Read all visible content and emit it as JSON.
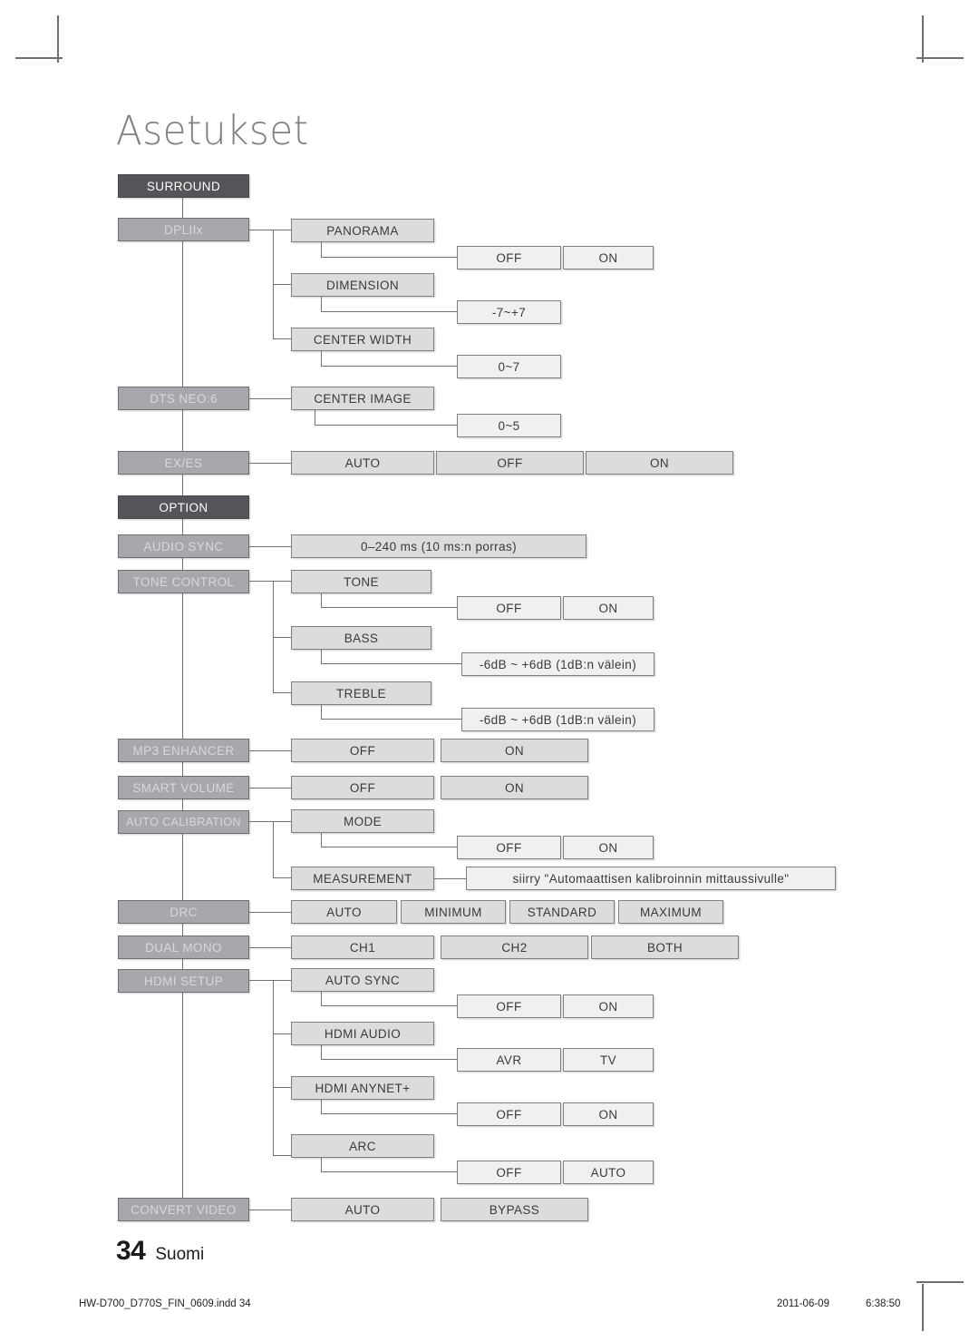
{
  "page": {
    "title": "Asetukset",
    "number": "34",
    "language": "Suomi"
  },
  "print_info": {
    "file": "HW-D700_D770S_FIN_0609.indd   34",
    "date": "2011-06-09",
    "time": "6:38:50"
  },
  "diagram": {
    "type": "tree",
    "nodes": {
      "surround": "SURROUND",
      "dpllix": "DPLIIx",
      "panorama": "PANORAMA",
      "panorama_off": "OFF",
      "panorama_on": "ON",
      "dimension": "DIMENSION",
      "dimension_range": "-7~+7",
      "center_width": "CENTER WIDTH",
      "center_width_range": "0~7",
      "dts_neo6": "DTS NEO:6",
      "center_image": "CENTER IMAGE",
      "center_image_range": "0~5",
      "ex_es": "EX/ES",
      "ex_es_auto": "AUTO",
      "ex_es_off": "OFF",
      "ex_es_on": "ON",
      "option": "OPTION",
      "audio_sync": "AUDIO SYNC",
      "audio_sync_range": "0–240 ms (10 ms:n porras)",
      "tone_control": "TONE CONTROL",
      "tone": "TONE",
      "tone_off": "OFF",
      "tone_on": "ON",
      "bass": "BASS",
      "bass_range": "-6dB ~ +6dB (1dB:n välein)",
      "treble": "TREBLE",
      "treble_range": "-6dB ~ +6dB (1dB:n välein)",
      "mp3_enhancer": "MP3 ENHANCER",
      "mp3_off": "OFF",
      "mp3_on": "ON",
      "smart_volume": "SMART VOLUME",
      "smart_off": "OFF",
      "smart_on": "ON",
      "auto_calibration": "AUTO CALIBRATION",
      "mode": "MODE",
      "mode_off": "OFF",
      "mode_on": "ON",
      "measurement": "MEASUREMENT",
      "measurement_note": "siirry \"Automaattisen kalibroinnin mittaussivulle\"",
      "drc": "DRC",
      "drc_auto": "AUTO",
      "drc_minimum": "MINIMUM",
      "drc_standard": "STANDARD",
      "drc_maximum": "MAXIMUM",
      "dual_mono": "DUAL MONO",
      "dual_ch1": "CH1",
      "dual_ch2": "CH2",
      "dual_both": "BOTH",
      "hdmi_setup": "HDMI SETUP",
      "auto_sync": "AUTO SYNC",
      "auto_sync_off": "OFF",
      "auto_sync_on": "ON",
      "hdmi_audio": "HDMI AUDIO",
      "hdmi_audio_avr": "AVR",
      "hdmi_audio_tv": "TV",
      "hdmi_anynet": "HDMI ANYNET+",
      "anynet_off": "OFF",
      "anynet_on": "ON",
      "arc": "ARC",
      "arc_off": "OFF",
      "arc_auto": "AUTO",
      "convert_video": "CONVERT VIDEO",
      "convert_auto": "AUTO",
      "convert_bypass": "BYPASS"
    },
    "colors": {
      "level0_bg": "#555559",
      "level1_bg": "#a8a8ac",
      "level2_bg": "#dcdcdc",
      "level3_bg": "#f0f0f0",
      "line": "#6f6f74",
      "title": "#808084"
    }
  }
}
